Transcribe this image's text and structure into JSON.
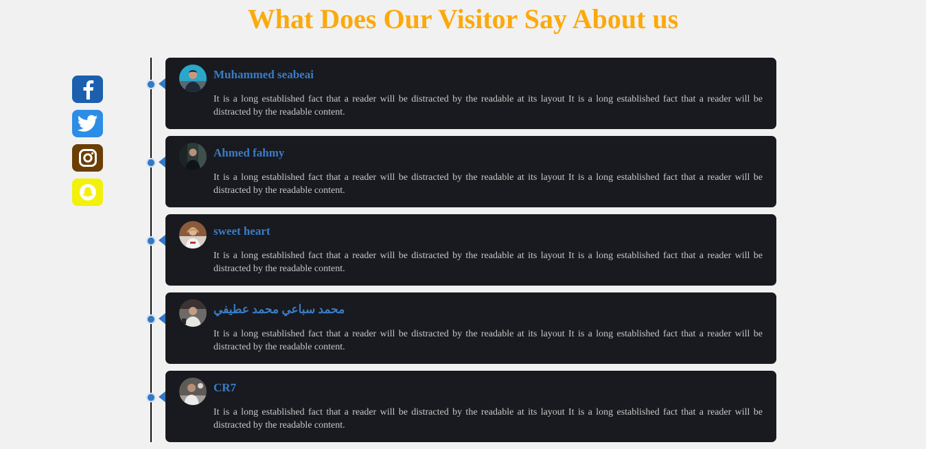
{
  "title": "What Does Our Visitor Say About us",
  "social": [
    {
      "name": "facebook-icon",
      "color": "#1b5fae"
    },
    {
      "name": "twitter-icon",
      "color": "#2d8de6"
    },
    {
      "name": "instagram-icon",
      "color": "#6b3e05"
    },
    {
      "name": "snapchat-icon",
      "color": "#f3f00b"
    }
  ],
  "accent": "#fca90c",
  "link_color": "#3a7cc6",
  "testimonials": [
    {
      "name": "Muhammed seabeai",
      "text": "It is a long established fact that a reader will be distracted by the readable at its layout It is a long established fact that a reader will be distracted by the readable content."
    },
    {
      "name": "Ahmed fahmy",
      "text": "It is a long established fact that a reader will be distracted by the readable at its layout It is a long established fact that a reader will be distracted by the readable content."
    },
    {
      "name": "sweet heart",
      "text": "It is a long established fact that a reader will be distracted by the readable at its layout It is a long established fact that a reader will be distracted by the readable content."
    },
    {
      "name": "محمد سباعي محمد عطيفي",
      "text": "It is a long established fact that a reader will be distracted by the readable at its layout It is a long established fact that a reader will be distracted by the readable content."
    },
    {
      "name": "CR7",
      "text": "It is a long established fact that a reader will be distracted by the readable at its layout It is a long established fact that a reader will be distracted by the readable content."
    }
  ]
}
